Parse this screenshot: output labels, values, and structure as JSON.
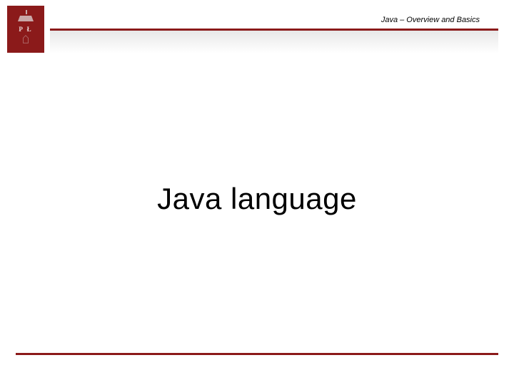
{
  "header": {
    "breadcrumb": "Java – Overview and Basics"
  },
  "logo": {
    "letters": "P Ł",
    "name": "university-logo"
  },
  "main": {
    "title": "Java language"
  },
  "colors": {
    "accent": "#8b1a1a"
  }
}
